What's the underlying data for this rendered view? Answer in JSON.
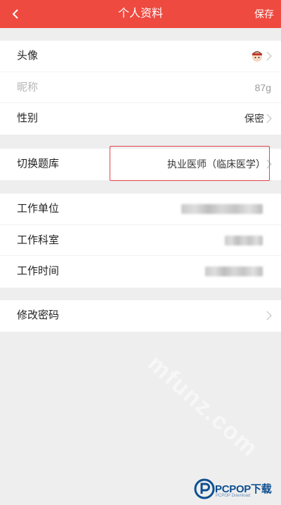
{
  "header": {
    "title": "个人资料",
    "save_label": "保存",
    "background": "#ef4a40"
  },
  "profile": {
    "rows": [
      {
        "label": "头像",
        "icon": "avatar-icon"
      },
      {
        "label": "昵称",
        "value": "87g"
      },
      {
        "label": "性别",
        "value": "保密"
      }
    ]
  },
  "question_bank": {
    "label": "切换题库",
    "value": "执业医师（临床医学）",
    "highlight_color": "#e5404a"
  },
  "work": {
    "rows": [
      {
        "label": "工作单位"
      },
      {
        "label": "工作科室"
      },
      {
        "label": "工作时间"
      }
    ]
  },
  "security": {
    "change_password_label": "修改密码"
  },
  "watermark": {
    "text": "mfunz.com"
  },
  "brand_logo": {
    "name": "PCPOP下载",
    "tagline": "PCPOP Download"
  }
}
